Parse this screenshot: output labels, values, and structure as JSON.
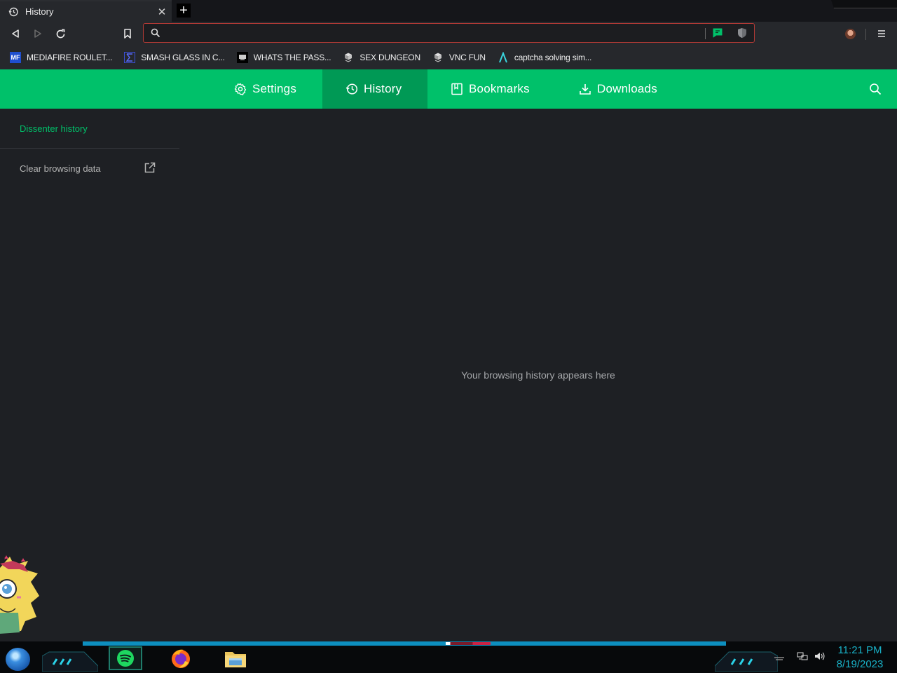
{
  "tab": {
    "title": "History",
    "close_glyph": "✕",
    "new_tab_glyph": "+"
  },
  "toolbar": {
    "url_value": "",
    "url_placeholder": ""
  },
  "bookmarks": [
    {
      "label": "MEDIAFIRE ROULET...",
      "icon": "mediafire-icon"
    },
    {
      "label": "SMASH GLASS IN C...",
      "icon": "sigma-icon"
    },
    {
      "label": "WHATS THE PASS...",
      "icon": "terminal-icon"
    },
    {
      "label": "SEX DUNGEON",
      "icon": "server-icon"
    },
    {
      "label": "VNC FUN",
      "icon": "server-icon"
    },
    {
      "label": "captcha solving sim...",
      "icon": "lambda-icon"
    }
  ],
  "nav": {
    "settings": "Settings",
    "history": "History",
    "bookmarks": "Bookmarks",
    "downloads": "Downloads"
  },
  "sidebar": {
    "heading": "Dissenter history",
    "clear": "Clear browsing data"
  },
  "main": {
    "empty_message": "Your browsing history appears here"
  },
  "taskbar": {
    "time": "11:21 PM",
    "date": "8/19/2023"
  },
  "colors": {
    "accent_green": "#00c16a",
    "active_green": "#009955",
    "background": "#1e2024",
    "clock": "#19b2c8"
  }
}
